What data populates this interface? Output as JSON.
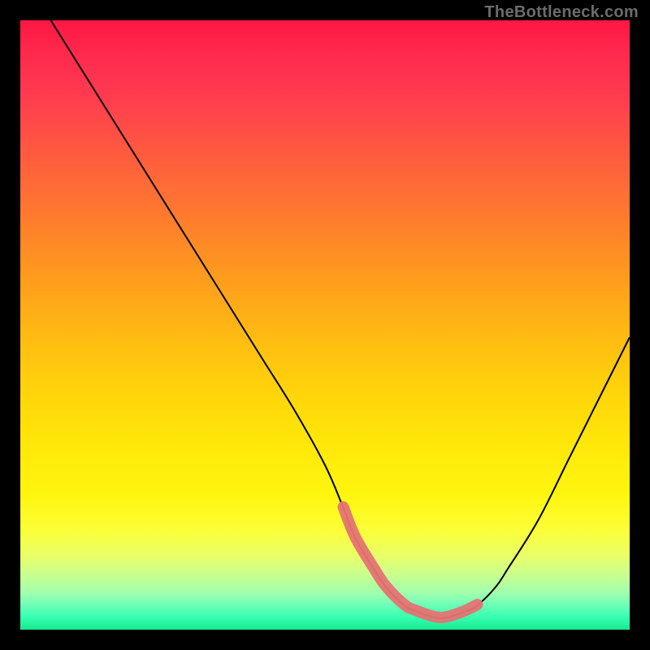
{
  "watermark": "TheBottleneck.com",
  "colors": {
    "line": "#000000",
    "highlight": "#e57373",
    "bg_top": "#ff1744",
    "bg_bottom": "#19e890"
  },
  "chart_data": {
    "type": "line",
    "title": "",
    "xlabel": "",
    "ylabel": "",
    "xlim": [
      0,
      100
    ],
    "ylim": [
      0,
      100
    ],
    "grid": false,
    "series": [
      {
        "name": "bottleneck-curve",
        "x": [
          5,
          10,
          15,
          20,
          25,
          30,
          35,
          40,
          45,
          50,
          53,
          55,
          58,
          60,
          63,
          65,
          68,
          70,
          73,
          75,
          78,
          80,
          85,
          90,
          95,
          100
        ],
        "y": [
          100,
          92,
          84,
          76,
          68,
          60,
          52,
          44,
          36,
          27,
          20,
          15,
          10,
          7,
          4,
          3,
          2,
          2,
          3,
          4,
          7,
          10,
          18,
          28,
          38,
          48
        ]
      }
    ],
    "highlight_range_x": [
      53,
      75
    ],
    "annotations": []
  }
}
